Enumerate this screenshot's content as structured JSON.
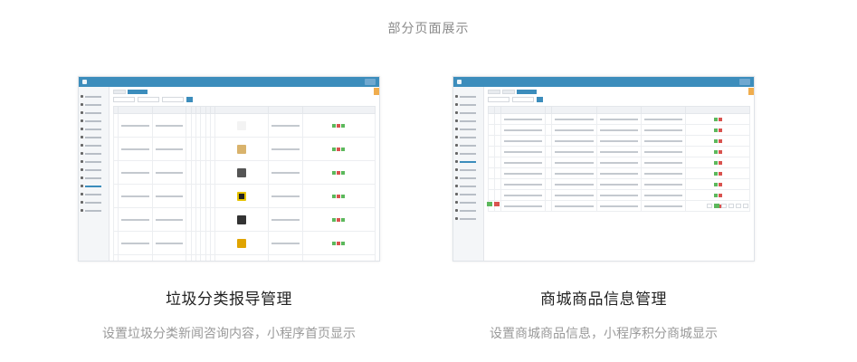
{
  "section": {
    "title": "部分页面展示"
  },
  "cards": [
    {
      "title": "垃圾分类报导管理",
      "description": "设置垃圾分类新闻咨询内容，小程序首页显示",
      "screenshot_alt": "垃圾分类报导管理"
    },
    {
      "title": "商城商品信息管理",
      "description": "设置商城商品信息，小程序积分商城显示",
      "screenshot_alt": "商城商品信息管理"
    }
  ],
  "colors": {
    "topbar": "#3c8dbc",
    "accent_green": "#5cb85c",
    "accent_red": "#d9534f",
    "accent_orange": "#f0ad4e"
  }
}
